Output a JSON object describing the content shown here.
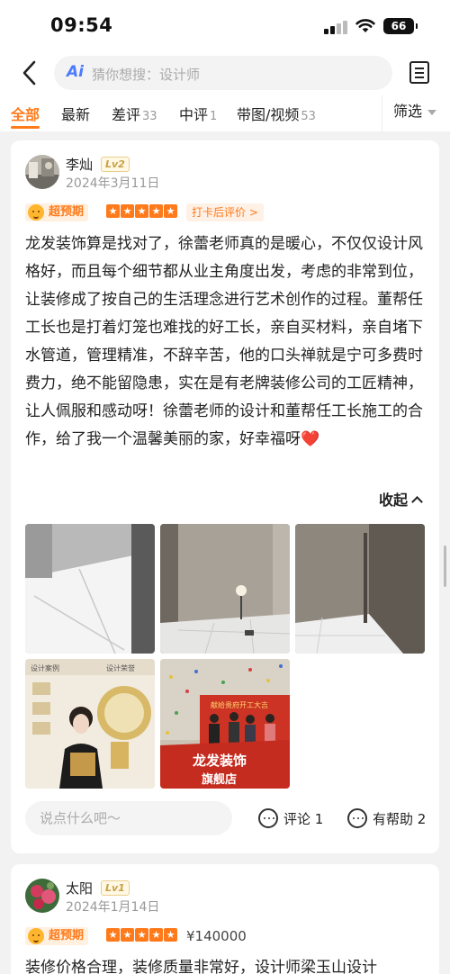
{
  "status_bar": {
    "time": "09:54",
    "battery": "66"
  },
  "search": {
    "ai_label": "Ai",
    "placeholder": "猜你想搜：设计师"
  },
  "tabs": [
    {
      "label": "全部",
      "count": ""
    },
    {
      "label": "最新",
      "count": ""
    },
    {
      "label": "差评",
      "count": "33"
    },
    {
      "label": "中评",
      "count": "1"
    },
    {
      "label": "带图/视频",
      "count": "53"
    }
  ],
  "filter_label": "筛选",
  "reviews": [
    {
      "name": "李灿",
      "level": "Lv2",
      "date": "2024年3月11日",
      "badge": "超预期",
      "stars": 5,
      "checkin": "打卡后评价 >",
      "text": "龙发装饰算是找对了，徐蕾老师真的是暖心，不仅仅设计风格好，而且每个细节都从业主角度出发，考虑的非常到位，让装修成了按自己的生活理念进行艺术创作的过程。董帮任工长也是打着灯笼也难找的好工长，亲自买材料，亲自堵下水管道，管理精准，不辞辛苦，他的口头禅就是宁可多费时费力，绝不能留隐患，实在是有老牌装修公司的工匠精神，让人佩服和感动呀！徐蕾老师的设计和董帮任工长施工的合作，给了我一个温馨美丽的家，好幸福呀",
      "heart": "❤️",
      "collapse_label": "收起",
      "photo_texts": {
        "p4_left": "设计案例",
        "p4_right": "设计荣誉",
        "p5_banner": "龙发装饰",
        "p5_sub": "旗舰店",
        "p5_top": "献给贵府开工大吉"
      },
      "comment_placeholder": "说点什么吧～",
      "comment_label": "评论",
      "comment_count": "1",
      "helpful_label": "有帮助",
      "helpful_count": "2"
    },
    {
      "name": "太阳",
      "level": "Lv1",
      "date": "2024年1月14日",
      "badge": "超预期",
      "stars": 5,
      "price": "¥140000",
      "text": "装修价格合理，装修质量非常好，设计师梁玉山设计"
    }
  ],
  "colors": {
    "accent": "#ff7a1a",
    "ai_blue": "#4b7bff"
  }
}
